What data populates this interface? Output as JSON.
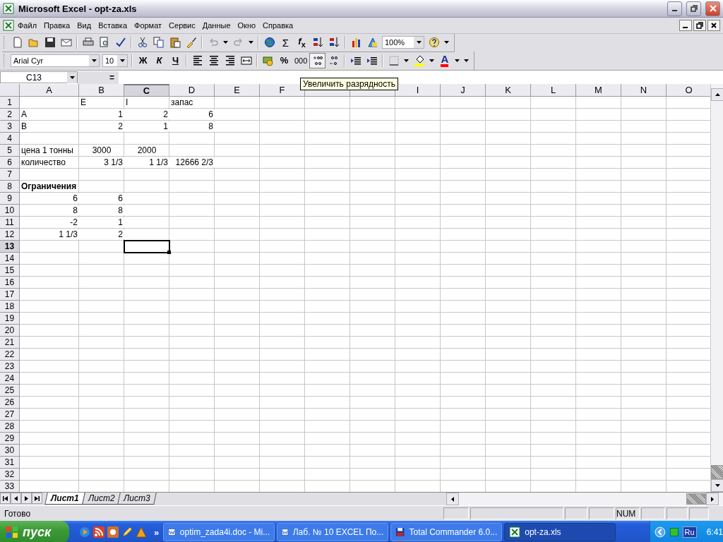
{
  "window": {
    "title": "Microsoft Excel - opt-za.xls"
  },
  "menu": [
    "Файл",
    "Правка",
    "Вид",
    "Вставка",
    "Формат",
    "Сервис",
    "Данные",
    "Окно",
    "Справка"
  ],
  "toolbar": {
    "sum": "Σ",
    "function": "*f*$_{x}$",
    "zoom": "100%"
  },
  "format_toolbar": {
    "font": "Arial Cyr",
    "size": "10",
    "style_buttons": [
      "Ж",
      "К",
      "Ч"
    ],
    "percent": "%",
    "thousands": "000",
    "increase_decimal": {
      "hovered": true
    },
    "font_color": "A"
  },
  "tooltip": "Увеличить разрядность",
  "formula_bar": {
    "name_box": "C13",
    "equals": "="
  },
  "sheet": {
    "columns": [
      {
        "label": "A",
        "selected": false
      },
      {
        "label": "B",
        "selected": false
      },
      {
        "label": "C",
        "selected": true
      },
      {
        "label": "D",
        "selected": false
      },
      {
        "label": "E",
        "selected": false
      },
      {
        "label": "F",
        "selected": false
      },
      {
        "selected": false
      },
      {
        "selected": false
      },
      {
        "label": "I",
        "selected": false
      },
      {
        "label": "J",
        "selected": false
      },
      {
        "label": "K",
        "selected": false
      },
      {
        "label": "L",
        "selected": false
      },
      {
        "label": "M",
        "selected": false
      },
      {
        "label": "N",
        "selected": false
      },
      {
        "label": "O",
        "selected": false
      }
    ],
    "rows": [
      {
        "label": "1",
        "selected": false,
        "cells": [
          {},
          {
            "text": "E",
            "kind": "text"
          },
          {
            "text": "I",
            "kind": "text"
          },
          {
            "text": "запас",
            "kind": "text"
          }
        ]
      },
      {
        "label": "2",
        "selected": false,
        "cells": [
          {
            "text": "A",
            "kind": "text"
          },
          {
            "text": "1",
            "kind": "number"
          },
          {
            "text": "2",
            "kind": "number"
          },
          {
            "text": "6",
            "kind": "number"
          }
        ]
      },
      {
        "label": "3",
        "selected": false,
        "cells": [
          {
            "text": "B",
            "kind": "text"
          },
          {
            "text": "2",
            "kind": "number"
          },
          {
            "text": "1",
            "kind": "number"
          },
          {
            "text": "8",
            "kind": "number"
          }
        ]
      },
      {
        "label": "4",
        "selected": false
      },
      {
        "label": "5",
        "selected": false,
        "cells": [
          {
            "text": "цена 1 тонны",
            "kind": "text"
          },
          {
            "text": "3000",
            "kind": "centered"
          },
          {
            "text": "2000",
            "kind": "centered"
          }
        ]
      },
      {
        "label": "6",
        "selected": false,
        "cells": [
          {
            "text": "количество",
            "kind": "text"
          },
          {
            "text": "3 1/3",
            "kind": "number"
          },
          {
            "text": "1 1/3",
            "kind": "number"
          },
          {
            "text": "12666 2/3",
            "kind": "number"
          }
        ]
      },
      {
        "label": "7",
        "selected": false
      },
      {
        "label": "8",
        "selected": false,
        "cells": [
          {
            "text": "Ограничения",
            "kind": "text",
            "bold": true
          }
        ]
      },
      {
        "label": "9",
        "selected": false,
        "cells": [
          {
            "text": "6",
            "kind": "number"
          },
          {
            "text": "6",
            "kind": "number"
          }
        ]
      },
      {
        "label": "10",
        "selected": false,
        "cells": [
          {
            "text": "8",
            "kind": "number"
          },
          {
            "text": "8",
            "kind": "number"
          }
        ]
      },
      {
        "label": "11",
        "selected": false,
        "cells": [
          {
            "text": "-2",
            "kind": "number"
          },
          {
            "text": "1",
            "kind": "number"
          }
        ]
      },
      {
        "label": "12",
        "selected": false,
        "cells": [
          {
            "text": "1 1/3",
            "kind": "number"
          },
          {
            "text": "2",
            "kind": "number"
          }
        ]
      },
      {
        "label": "13",
        "selected": true,
        "cells": [
          {},
          {},
          {
            "selected": true
          }
        ]
      },
      {
        "label": "14",
        "selected": false
      },
      {
        "label": "15",
        "selected": false
      },
      {
        "label": "16",
        "selected": false
      },
      {
        "label": "17",
        "selected": false
      },
      {
        "label": "18",
        "selected": false
      },
      {
        "label": "19",
        "selected": false
      },
      {
        "label": "20",
        "selected": false
      },
      {
        "label": "21",
        "selected": false
      },
      {
        "label": "22",
        "selected": false
      },
      {
        "label": "23",
        "selected": false
      },
      {
        "label": "24",
        "selected": false
      },
      {
        "label": "25",
        "selected": false
      },
      {
        "label": "26",
        "selected": false
      },
      {
        "label": "27",
        "selected": false
      },
      {
        "label": "28",
        "selected": false
      },
      {
        "label": "29",
        "selected": false
      },
      {
        "label": "30",
        "selected": false
      },
      {
        "label": "31",
        "selected": false
      },
      {
        "label": "32",
        "selected": false
      },
      {
        "label": "33",
        "selected": false
      }
    ]
  },
  "sheet_tabs": [
    {
      "label": "Лист1",
      "selected": true
    },
    {
      "label": "Лист2",
      "selected": false
    },
    {
      "label": "Лист3",
      "selected": false
    }
  ],
  "status_bar": {
    "text": "Готово",
    "indicators": [
      "NUM"
    ]
  },
  "taskbar": {
    "start": "пуск",
    "more": "»",
    "tasks": [
      {
        "label": "optim_zada4i.doc - Mi...",
        "kind": "word",
        "selected": false
      },
      {
        "label": "Лаб. № 10 EXCEL По...",
        "kind": "word",
        "selected": false
      },
      {
        "label": "Total Commander 6.0...",
        "kind": "commander",
        "selected": false
      },
      {
        "label": "opt-za.xls",
        "kind": "excel",
        "selected": true
      }
    ],
    "language": "Ru",
    "clock": "6:41"
  }
}
